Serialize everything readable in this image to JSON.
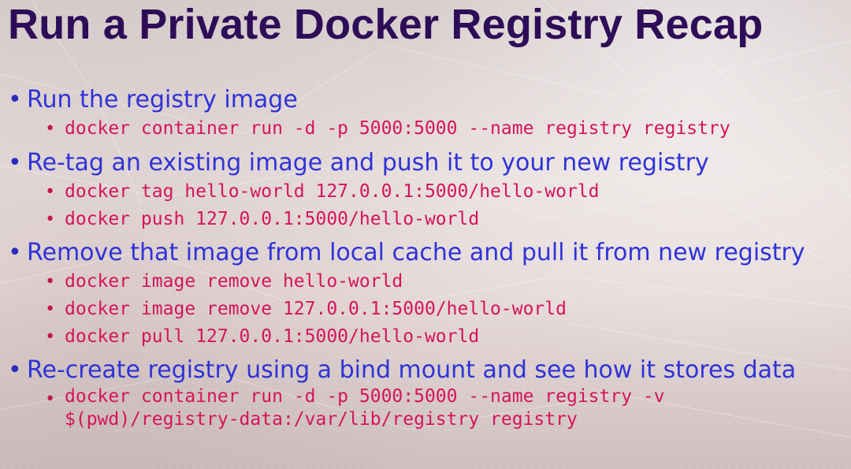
{
  "slide": {
    "title": "Run a Private Docker Registry Recap",
    "bullets": [
      {
        "text": "Run the registry image",
        "subs": [
          "docker container run -d -p 5000:5000 --name registry registry"
        ]
      },
      {
        "text": "Re-tag an existing image and push it to your new registry",
        "subs": [
          "docker tag hello-world 127.0.0.1:5000/hello-world",
          "docker push 127.0.0.1:5000/hello-world"
        ]
      },
      {
        "text": "Remove that image from local cache and pull it from new registry",
        "subs": [
          "docker image remove hello-world",
          "docker image remove 127.0.0.1:5000/hello-world",
          "docker pull 127.0.0.1:5000/hello-world"
        ]
      },
      {
        "text": "Re-create registry using a bind mount and see how it stores data",
        "subs": [
          "docker container run -d -p 5000:5000 --name registry -v $(pwd)/registry-data:/var/lib/registry registry"
        ]
      }
    ]
  },
  "colors": {
    "title": "#2e0d58",
    "bullet": "#2f33d7",
    "code": "#d4145b",
    "background": "#e7dbda"
  }
}
